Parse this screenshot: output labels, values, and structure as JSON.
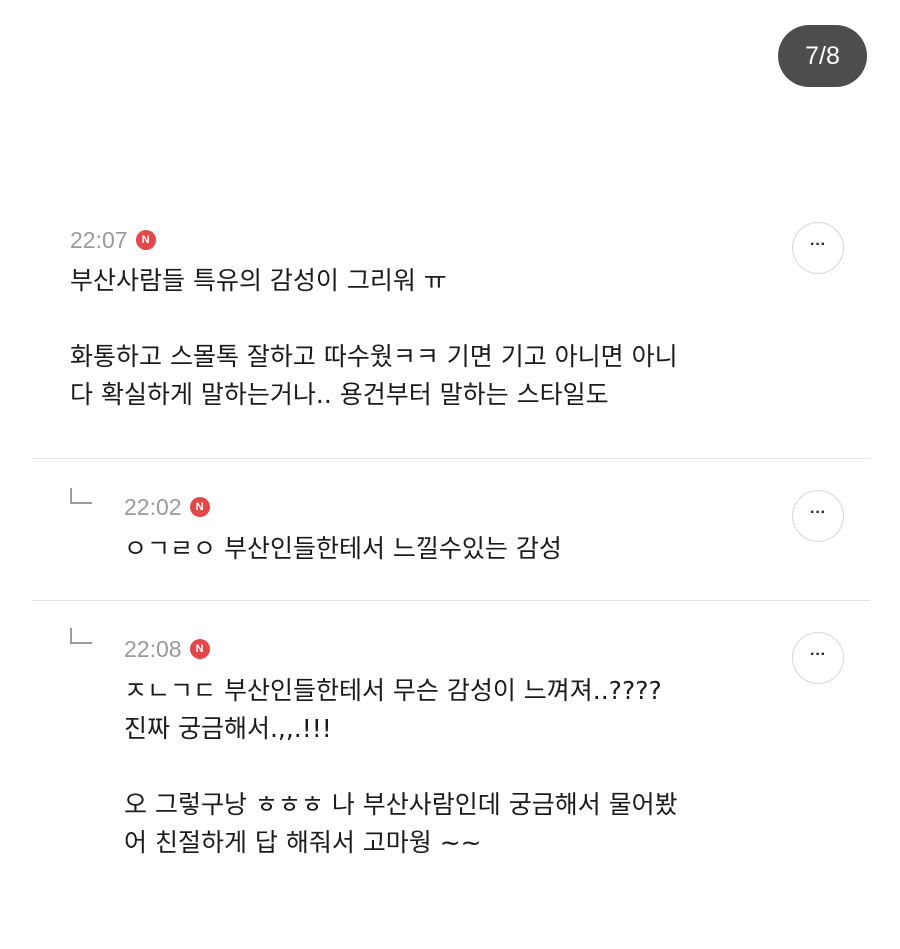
{
  "page_indicator": "7/8",
  "comments": [
    {
      "time": "22:07",
      "badge": "N",
      "text": "부산사람들 특유의 감성이 그리워 ㅠ\n\n화통하고 스몰톡 잘하고 따수웠ㅋㅋ 기면 기고 아니면 아니\n다 확실하게 말하는거나.. 용건부터 말하는 스타일도",
      "more_label": "···"
    },
    {
      "time": "22:02",
      "badge": "N",
      "text": "ㅇㄱㄹㅇ 부산인들한테서 느낄수있는 감성",
      "more_label": "···"
    },
    {
      "time": "22:08",
      "badge": "N",
      "text": "ㅈㄴㄱㄷ 부산인들한테서 무슨 감성이 느껴져..????\n진짜 궁금해서.,,.!!!\n\n오 그렇구낭 ㅎㅎㅎ 나 부산사람인데 궁금해서 물어봤\n어 친절하게 답 해줘서 고마웡 ~~",
      "more_label": "···"
    }
  ]
}
